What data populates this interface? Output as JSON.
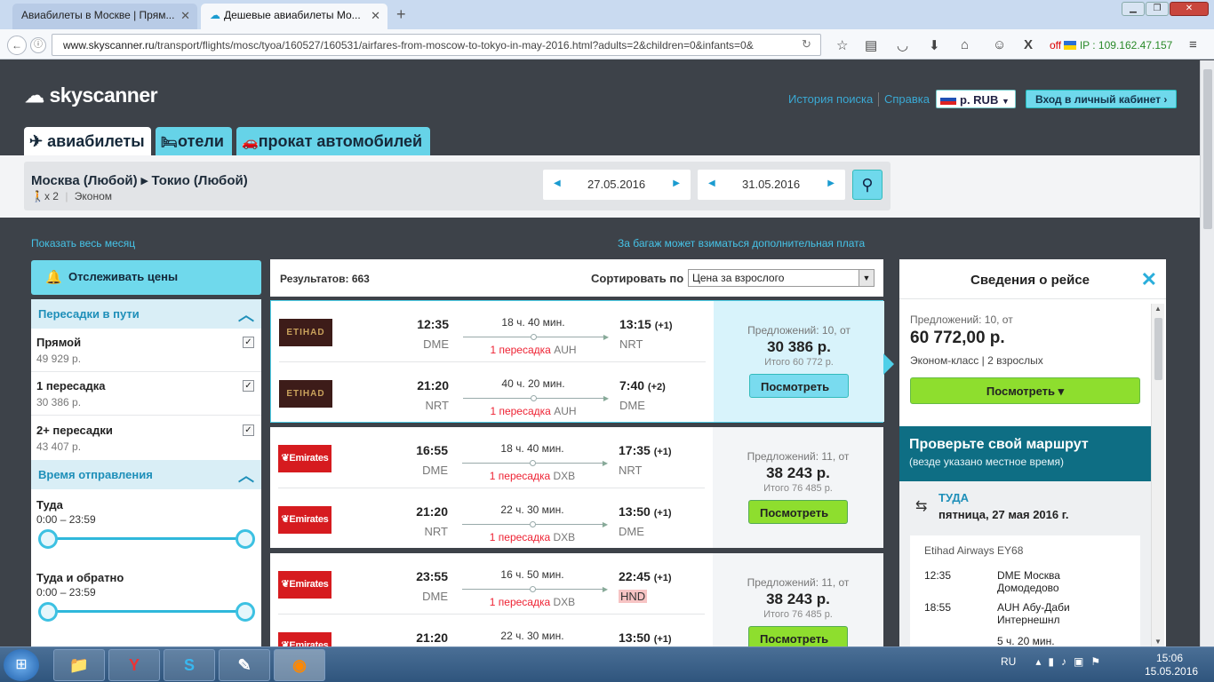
{
  "browser": {
    "tabs": [
      {
        "title": "Авиабилеты в Москве | Прям...",
        "active": false
      },
      {
        "title": "Дешевые авиабилеты Мо...",
        "active": true
      }
    ],
    "url_domain": "www.skyscanner.ru",
    "url_path": "/transport/flights/mosc/tyoa/160527/160531/airfares-from-moscow-to-tokyo-in-may-2016.html?adults=2&children=0&infants=0&",
    "off_label": "off",
    "ip_label": "IP : 109.162.47.157"
  },
  "header": {
    "logo": "skyscanner",
    "history": "История поиска",
    "help": "Справка",
    "currency": "р. RUB",
    "login": "Вход в личный кабинет ›"
  },
  "nav_tabs": [
    {
      "label": "авиабилеты",
      "icon": "plane-icon"
    },
    {
      "label": "отели",
      "icon": "bed-icon"
    },
    {
      "label": "прокат автомобилей",
      "icon": "car-icon"
    }
  ],
  "search": {
    "route": "Москва (Любой) ▸ Токио (Любой)",
    "pax": "x 2",
    "cabin": "Эконом",
    "depart_date": "27.05.2016",
    "return_date": "31.05.2016"
  },
  "links": {
    "whole_month": "Показать весь месяц",
    "baggage": "За багаж может взиматься дополнительная плата"
  },
  "watch_button": "Отслеживать цены",
  "filters": {
    "stops_title": "Пересадки в пути",
    "stops": [
      {
        "label": "Прямой",
        "price": "49 929 р.",
        "checked": true
      },
      {
        "label": "1 пересадка",
        "price": "30 386 р.",
        "checked": true
      },
      {
        "label": "2+ пересадки",
        "price": "43 407 р.",
        "checked": true
      }
    ],
    "time_title": "Время отправления",
    "outbound": {
      "label": "Туда",
      "range": "0:00 – 23:59"
    },
    "roundtrip": {
      "label": "Туда и обратно",
      "range": "0:00 – 23:59"
    }
  },
  "results": {
    "count_label": "Результатов: 663",
    "sort_label": "Сортировать по",
    "sort_value": "Цена за взрослого",
    "items": [
      {
        "airline": "ETIHAD",
        "airline_sub": "AIRWAYS",
        "selected": true,
        "legs": [
          {
            "dep": "12:35",
            "dep_code": "DME",
            "duration": "18 ч. 40 мин.",
            "stops": "1 пересадка",
            "via": "AUH",
            "arr": "13:15",
            "plus": "(+1)",
            "arr_code": "NRT"
          },
          {
            "dep": "21:20",
            "dep_code": "NRT",
            "duration": "40 ч. 20 мин.",
            "stops": "1 пересадка",
            "via": "AUH",
            "arr": "7:40",
            "plus": "(+2)",
            "arr_code": "DME"
          }
        ],
        "offers": "Предложений: 10, от",
        "price": "30 386 р.",
        "total": "Итого 60 772 р.",
        "button": "Посмотреть"
      },
      {
        "airline": "Emirates",
        "selected": false,
        "legs": [
          {
            "dep": "16:55",
            "dep_code": "DME",
            "duration": "18 ч. 40 мин.",
            "stops": "1 пересадка",
            "via": "DXB",
            "arr": "17:35",
            "plus": "(+1)",
            "arr_code": "NRT"
          },
          {
            "dep": "21:20",
            "dep_code": "NRT",
            "duration": "22 ч. 30 мин.",
            "stops": "1 пересадка",
            "via": "DXB",
            "arr": "13:50",
            "plus": "(+1)",
            "arr_code": "DME"
          }
        ],
        "offers": "Предложений: 11, от",
        "price": "38 243 р.",
        "total": "Итого 76 485 р.",
        "button": "Посмотреть"
      },
      {
        "airline": "Emirates",
        "selected": false,
        "legs": [
          {
            "dep": "23:55",
            "dep_code": "DME",
            "duration": "16 ч. 50 мин.",
            "stops": "1 пересадка",
            "via": "DXB",
            "arr": "22:45",
            "plus": "(+1)",
            "arr_code": "HND"
          },
          {
            "dep": "21:20",
            "dep_code": "NRT",
            "duration": "22 ч. 30 мин.",
            "stops": "",
            "via": "",
            "arr": "13:50",
            "plus": "(+1)",
            "arr_code": "DME"
          }
        ],
        "offers": "Предложений: 11, от",
        "price": "38 243 р.",
        "total": "Итого 76 485 р.",
        "button": "Посмотреть"
      }
    ]
  },
  "details": {
    "title": "Сведения о рейсе",
    "offers": "Предложений: 10, от",
    "price": "60 772,00 р.",
    "class_line": "Эконом-класс  |  2 взрослых",
    "button": "Посмотреть ▾",
    "check_title": "Проверьте свой маршрут",
    "check_sub": "(везде указано местное время)",
    "direction": "ТУДА",
    "date": "пятница, 27 мая 2016 г.",
    "flight": "Etihad Airways EY68",
    "rows": [
      {
        "time": "12:35",
        "place": "DME Москва Домодедово"
      },
      {
        "time": "18:55",
        "place": "AUH Абу-Даби Интернешнл"
      },
      {
        "time": "",
        "place": "5 ч. 20 мин."
      }
    ]
  },
  "taskbar": {
    "lang": "RU",
    "time": "15:06",
    "date": "15.05.2016"
  },
  "colors": {
    "brand_cyan": "#6fd9ec",
    "accent_link": "#1e8fb9",
    "cta_green": "#8ede2e",
    "page_dark": "#3d4249"
  }
}
